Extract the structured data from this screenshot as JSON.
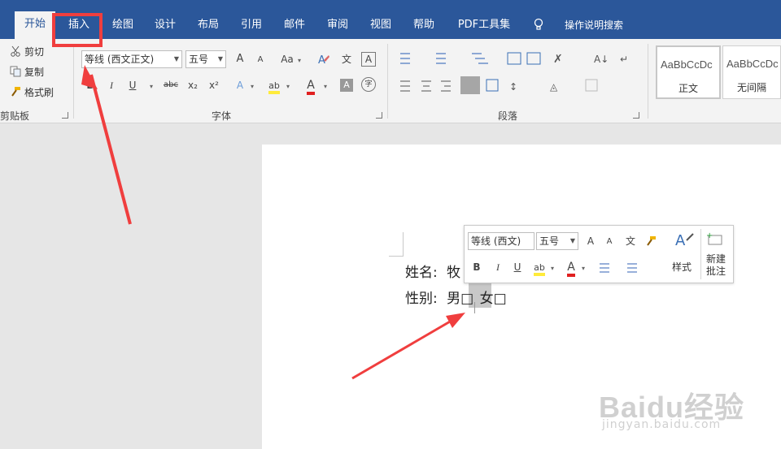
{
  "tabs": [
    {
      "label": "开始"
    },
    {
      "label": "插入"
    },
    {
      "label": "绘图"
    },
    {
      "label": "设计"
    },
    {
      "label": "布局"
    },
    {
      "label": "引用"
    },
    {
      "label": "邮件"
    },
    {
      "label": "审阅"
    },
    {
      "label": "视图"
    },
    {
      "label": "帮助"
    },
    {
      "label": "PDF工具集"
    }
  ],
  "tell_me": "操作说明搜索",
  "clipboard": {
    "cut": "剪切",
    "copy": "复制",
    "format_painter": "格式刷",
    "group_label": "剪贴板"
  },
  "font": {
    "font_name": "等线 (西文正文)",
    "font_size": "五号",
    "grow": "A",
    "shrink": "A",
    "change_case": "Aa",
    "phonetic": "文",
    "char_border": "A",
    "bold": "B",
    "italic": "I",
    "underline": "U",
    "strike": "abc",
    "subscript": "x₂",
    "superscript": "x²",
    "text_effects": "A",
    "highlight": "ab",
    "font_color": "A",
    "char_shading": "A",
    "enclose": "字",
    "group_label": "字体"
  },
  "paragraph": {
    "group_label": "段落"
  },
  "styles": [
    {
      "sample": "AaBbCcDc",
      "name": "正文"
    },
    {
      "sample": "AaBbCcDc",
      "name": "无间隔"
    }
  ],
  "document": {
    "line1_label": "姓名:",
    "line1_value": "牧",
    "line2_label": "性别:",
    "male": "男",
    "male_box": "□",
    "female": "女",
    "female_box": "□"
  },
  "mini_toolbar": {
    "font_name": "等线 (西文)",
    "font_size": "五号",
    "bold": "B",
    "italic": "I",
    "underline": "U",
    "styles_label": "样式",
    "new_comment_label_1": "新建",
    "new_comment_label_2": "批注"
  },
  "watermark": {
    "text": "Baidu经验",
    "url": "jingyan.baidu.com"
  },
  "colors": {
    "ribbon_blue": "#2b579a",
    "annotation_red": "#f03e3e",
    "highlight_yellow": "#ffeb3b",
    "font_red": "#e02020"
  }
}
